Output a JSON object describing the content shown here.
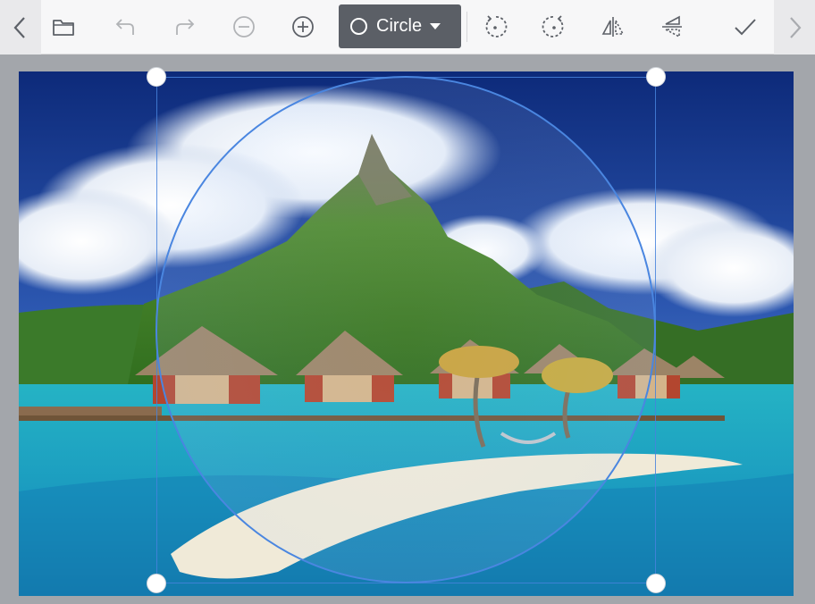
{
  "toolbar": {
    "shape_label": "Circle",
    "icons": [
      "chevron-left-icon",
      "folder-icon",
      "undo-icon",
      "redo-icon",
      "zoom-out-icon",
      "zoom-in-icon",
      "rotate-left-icon",
      "rotate-right-icon",
      "flip-horizontal-icon",
      "flip-vertical-icon",
      "check-icon",
      "chevron-right-icon"
    ]
  },
  "colors": {
    "toolbar_bg": "#f7f7f8",
    "selector_bg": "#5b5f66",
    "crop_accent": "#4a86e0",
    "canvas_bg": "#a3a6ab"
  }
}
